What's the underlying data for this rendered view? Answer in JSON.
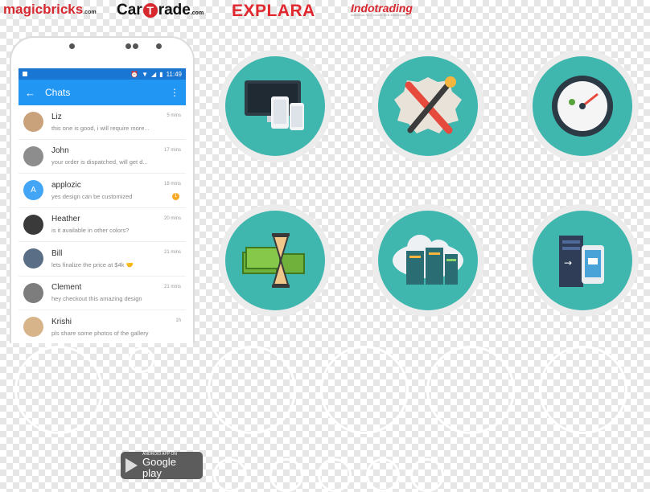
{
  "logos": {
    "magicbricks": "magicbricks",
    "magicbricks_suffix": ".com",
    "cartrade_a": "Car",
    "cartrade_t": "T",
    "cartrade_b": "rade",
    "cartrade_suffix": ".com",
    "explara": "EXPLARA",
    "indotrading": "Indotrading",
    "indotrading_tagline": "Indonesia No.1 Online B2B Marketplace"
  },
  "phone": {
    "status_time": "11:49",
    "title": "Chats",
    "chats": [
      {
        "name": "Liz",
        "message": "this one is good, i will require more...",
        "time": "5 mins",
        "avatar_color": "#c9a27c"
      },
      {
        "name": "John",
        "message": "your order is dispatched, will get d...",
        "time": "17 mins",
        "avatar_color": "#8d8d8d"
      },
      {
        "name": "applozic",
        "message": "yes design can be customized",
        "time": "18 mins",
        "avatar_letter": "A",
        "avatar_color": "#42a5f5",
        "badge": "1"
      },
      {
        "name": "Heather",
        "message": "is it available in other colors?",
        "time": "20 mins",
        "avatar_color": "#3a3a3a"
      },
      {
        "name": "Bill",
        "message": "lets finalize the price at $4k 🤝",
        "time": "21 mins",
        "avatar_color": "#5a6e86"
      },
      {
        "name": "Clement",
        "message": "hey checkout this amazing design",
        "time": "21 mins",
        "avatar_color": "#7d7d7d"
      },
      {
        "name": "Krishi",
        "message": "pls share some photos of the gallery",
        "time": "1h",
        "avatar_color": "#d8b48a"
      }
    ]
  },
  "feature_icons": [
    "devices-icon",
    "tools-icon",
    "speedometer-icon",
    "money-time-icon",
    "cloud-server-icon",
    "server-mobile-icon"
  ],
  "google_play": {
    "small": "ANDROID APP ON",
    "big": "Google play"
  },
  "colors": {
    "teal": "#3fb6ae",
    "appbar": "#2196f3"
  }
}
